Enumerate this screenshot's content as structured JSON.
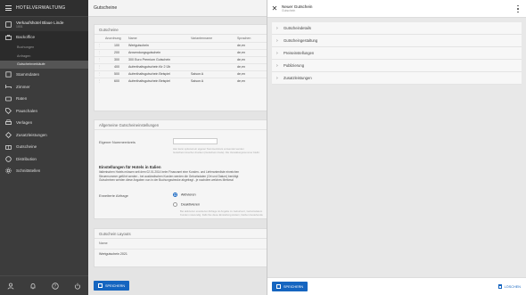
{
  "sidebar": {
    "app_title": "HOTELVERWALTUNG",
    "hotel_name": "Verkaufshotel Blaue Linde",
    "hotel_id": "1001",
    "items": [
      {
        "label": "Backoffice",
        "icon": "briefcase-icon"
      },
      {
        "label": "Stammdaten",
        "icon": "database-icon"
      },
      {
        "label": "Zimmer",
        "icon": "bed-icon"
      },
      {
        "label": "Raten",
        "icon": "rates-icon"
      },
      {
        "label": "Pauschalen",
        "icon": "tag-icon"
      },
      {
        "label": "Verlagen",
        "icon": "print-icon"
      },
      {
        "label": "Zusatzleistungen",
        "icon": "services-icon"
      },
      {
        "label": "Gutscheine",
        "icon": "gift-icon"
      },
      {
        "label": "Distribution",
        "icon": "distribution-icon"
      },
      {
        "label": "Schnittstellen",
        "icon": "gear-icon"
      }
    ],
    "subitems": [
      "Buchungen",
      "Anfragen",
      "Gutscheinverkäufe"
    ]
  },
  "main": {
    "title": "Gutscheine",
    "list_title": "Gutscheine",
    "columns": [
      "Anordnung",
      "Name",
      "Variantenname",
      "Sprachen"
    ],
    "rows": [
      [
        "100",
        "Wertgutschein",
        "",
        "de,en"
      ],
      [
        "200",
        "Anwendungsgutschein",
        "",
        "de,en"
      ],
      [
        "300",
        "300 Euro Premium Gutschein",
        "",
        "de,en"
      ],
      [
        "400",
        "Aufenthaltsgutschein für 2 Üb",
        "",
        "de,en"
      ],
      [
        "500",
        "Aufenthaltsgutschein Beispiel",
        "Saison A",
        "de,en"
      ],
      [
        "600",
        "Aufenthaltsgutschein Beispiel",
        "Saison A",
        "de,en"
      ]
    ],
    "settings_title": "Allgemeine Gutscheineinstellungen",
    "own_number_label": "Eigener Nummernkreis",
    "own_number_hint1": "Hier kann optional ein eigener Nummernkreis verwendet werden",
    "own_number_hint2": "Gutschein-Voucher drucken (Gutschein-Code). Die Verwaltungsnummer bleibt",
    "italy_title": "Einstellungen für Hotels in Italien",
    "italy_text1": "Italienischen Hotels müssen seit dem 02.01.2014 beim Finanzamt eine Kunden- und Lieferantenliste einreichen",
    "italy_text2": "Steuernummer geführt werden - bei ausländischen Kunden werden die Geburtsdaten (Ort und Datum) benötigt",
    "italy_text3": "Gutscheinen werden diese Angaben nun in der Buchungsstrecke abgefragt - je nachdem welches Merkmal",
    "extended_label": "Erweiterte Abfrage",
    "opt_on": "Aktivieren",
    "opt_off": "Deaktivieren",
    "opt_hint1": "Bei aktivierter erweiterter Abfrage ist Angabe zu Geburtsort, Geburtsdatum",
    "opt_hint2": "Kunden notwendig. Falls Sie diese Einstellung ändern, bleiben bestehende",
    "layouts_title": "Gutschein Layouts",
    "layouts_col": "Name",
    "layouts_row": "Wertgutschein 2021",
    "save_label": "SPEICHERN"
  },
  "panel": {
    "title": "Neuer Gutschein",
    "subtitle": "Gutschein",
    "sections": [
      "Gutscheindetails",
      "Gutscheingestaltung",
      "Preiseinstellungen",
      "Publizierung",
      "Zusatzleistungen"
    ],
    "save_label": "SPEICHERN",
    "delete_label": "LÖSCHEN"
  },
  "colors": {
    "accent": "#1565c0",
    "sidebar": "#3c3c3c"
  }
}
